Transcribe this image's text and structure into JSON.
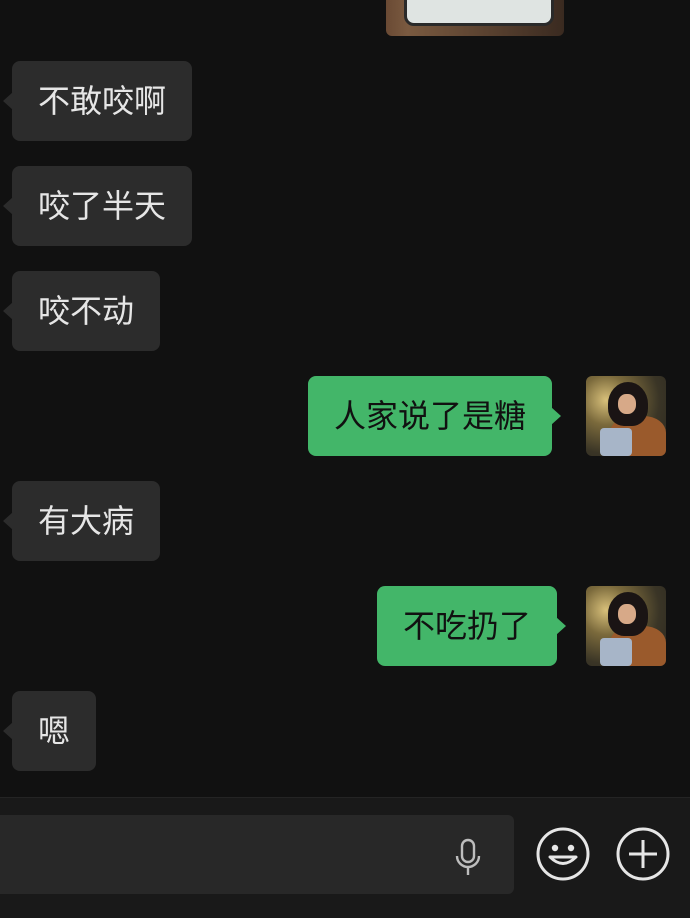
{
  "chat": {
    "messages": [
      {
        "side": "received",
        "type": "image"
      },
      {
        "side": "received",
        "text": "不敢咬啊"
      },
      {
        "side": "received",
        "text": "咬了半天"
      },
      {
        "side": "received",
        "text": "咬不动"
      },
      {
        "side": "sent",
        "text": "人家说了是糖",
        "avatar": "user-avatar"
      },
      {
        "side": "received",
        "text": "有大病"
      },
      {
        "side": "sent",
        "text": "不吃扔了",
        "avatar": "user-avatar"
      },
      {
        "side": "received",
        "text": "嗯"
      }
    ]
  },
  "input_bar": {
    "value": "",
    "icons": [
      "microphone-icon",
      "emoji-icon",
      "plus-icon"
    ]
  },
  "colors": {
    "background": "#111111",
    "received_bubble": "#2c2c2c",
    "sent_bubble": "#43b669",
    "input_bar": "#191919"
  }
}
